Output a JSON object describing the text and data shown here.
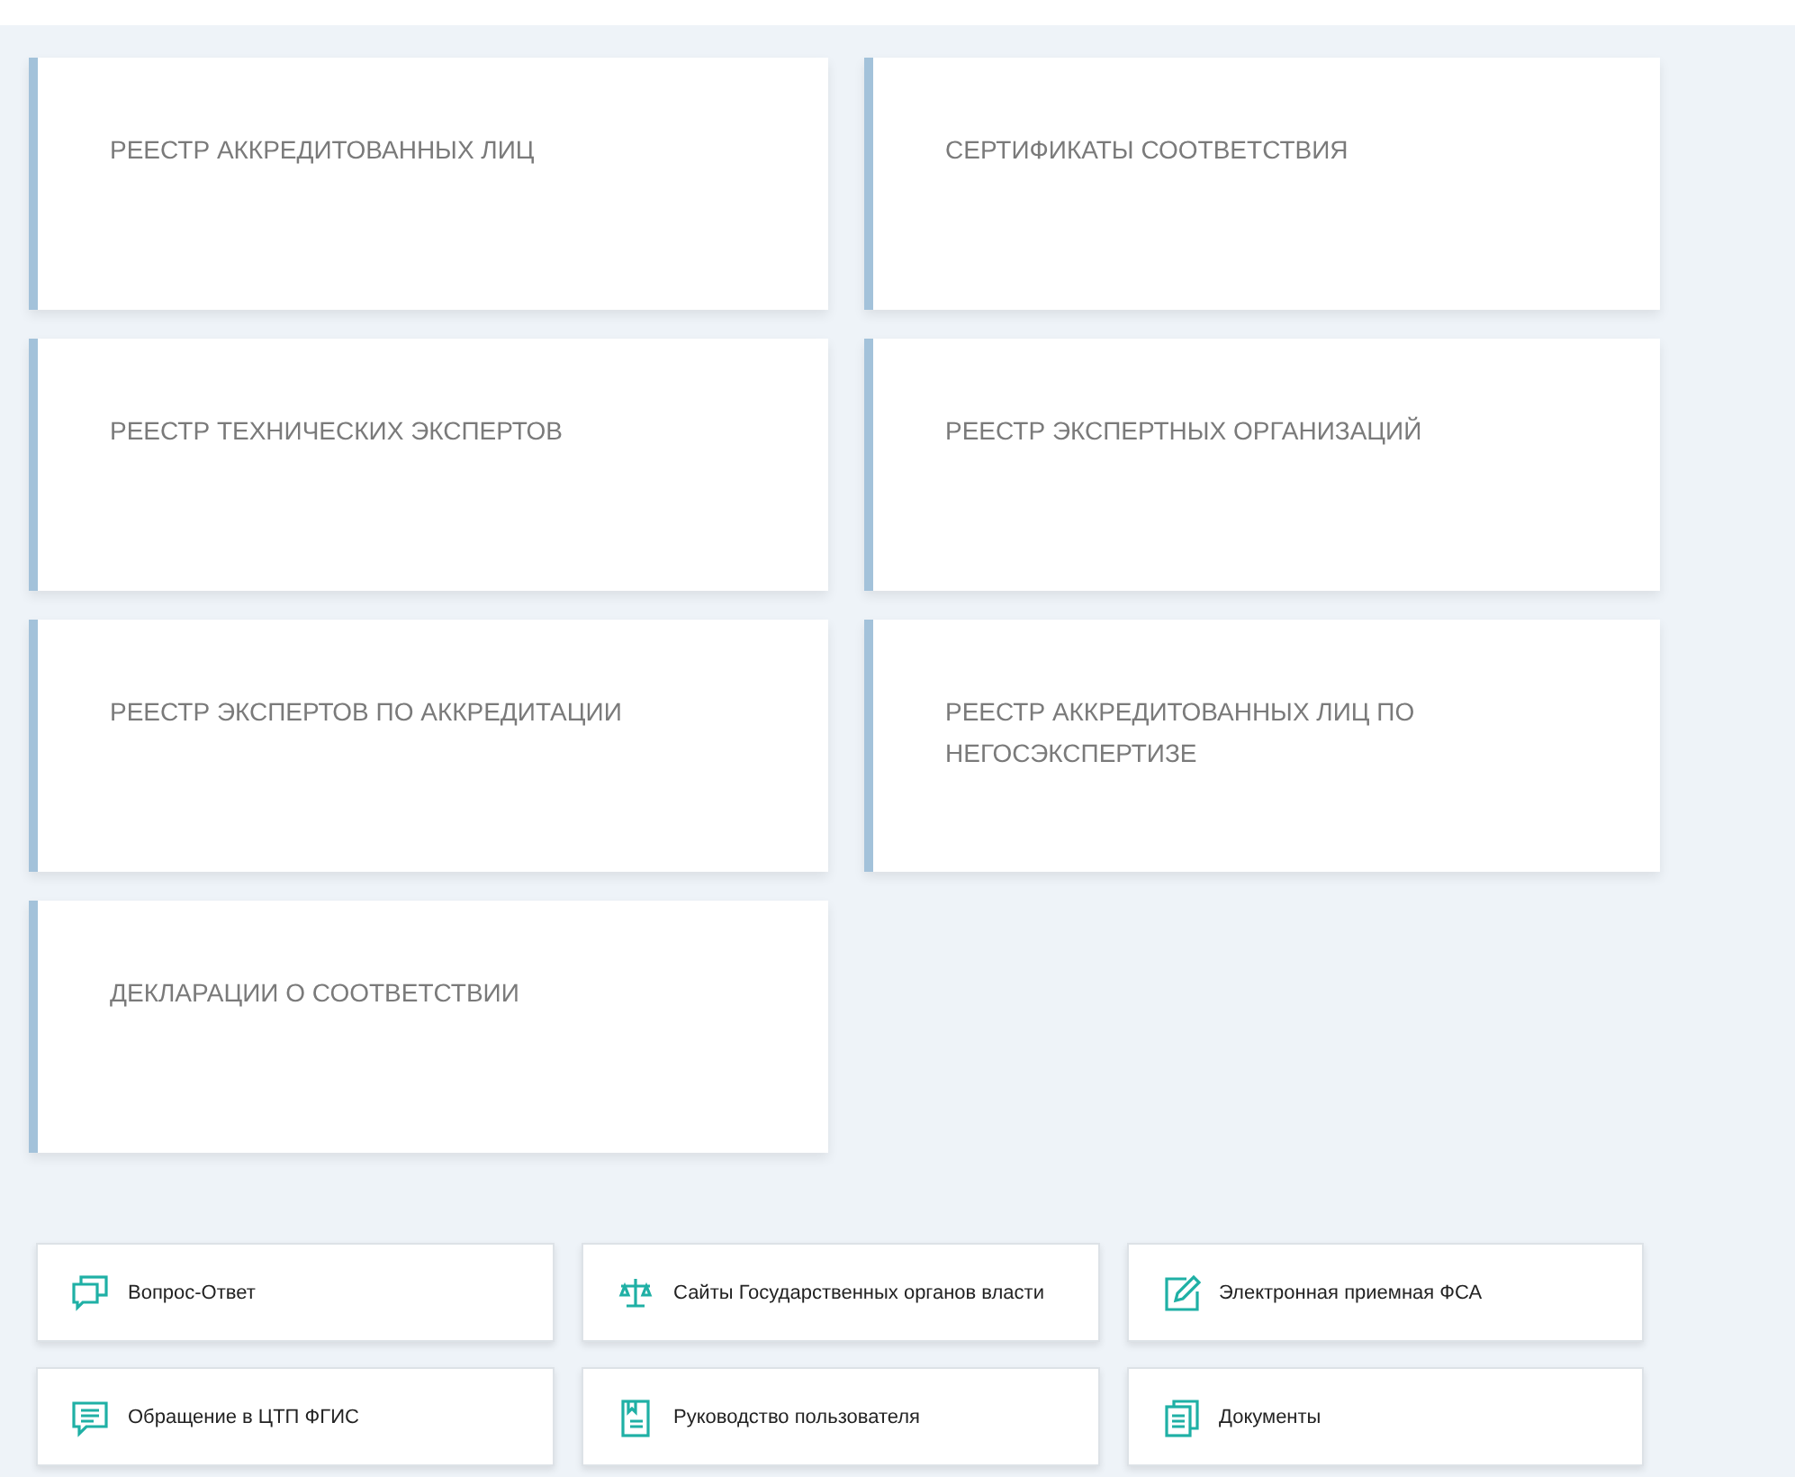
{
  "registries": [
    {
      "title": "РЕЕСТР АККРЕДИТОВАННЫХ ЛИЦ"
    },
    {
      "title": "СЕРТИФИКАТЫ СООТВЕТСТВИЯ"
    },
    {
      "title": "РЕЕСТР ТЕХНИЧЕСКИХ ЭКСПЕРТОВ"
    },
    {
      "title": "РЕЕСТР ЭКСПЕРТНЫХ ОРГАНИЗАЦИЙ"
    },
    {
      "title": "РЕЕСТР ЭКСПЕРТОВ ПО АККРЕДИТАЦИИ"
    },
    {
      "title": "РЕЕСТР АККРЕДИТОВАННЫХ ЛИЦ ПО НЕГОСЭКСПЕРТИЗЕ"
    },
    {
      "title": "ДЕКЛАРАЦИИ О СООТВЕТСТВИИ"
    }
  ],
  "links": [
    {
      "label": "Вопрос-Ответ",
      "kind": "chat"
    },
    {
      "label": "Сайты Государственных органов власти",
      "kind": "scales"
    },
    {
      "label": "Электронная приемная ФСА",
      "kind": "edit"
    },
    {
      "label": "Обращение в ЦТП ФГИС",
      "kind": "message"
    },
    {
      "label": "Руководство пользователя",
      "kind": "manual"
    },
    {
      "label": "Документы",
      "kind": "documents"
    }
  ]
}
